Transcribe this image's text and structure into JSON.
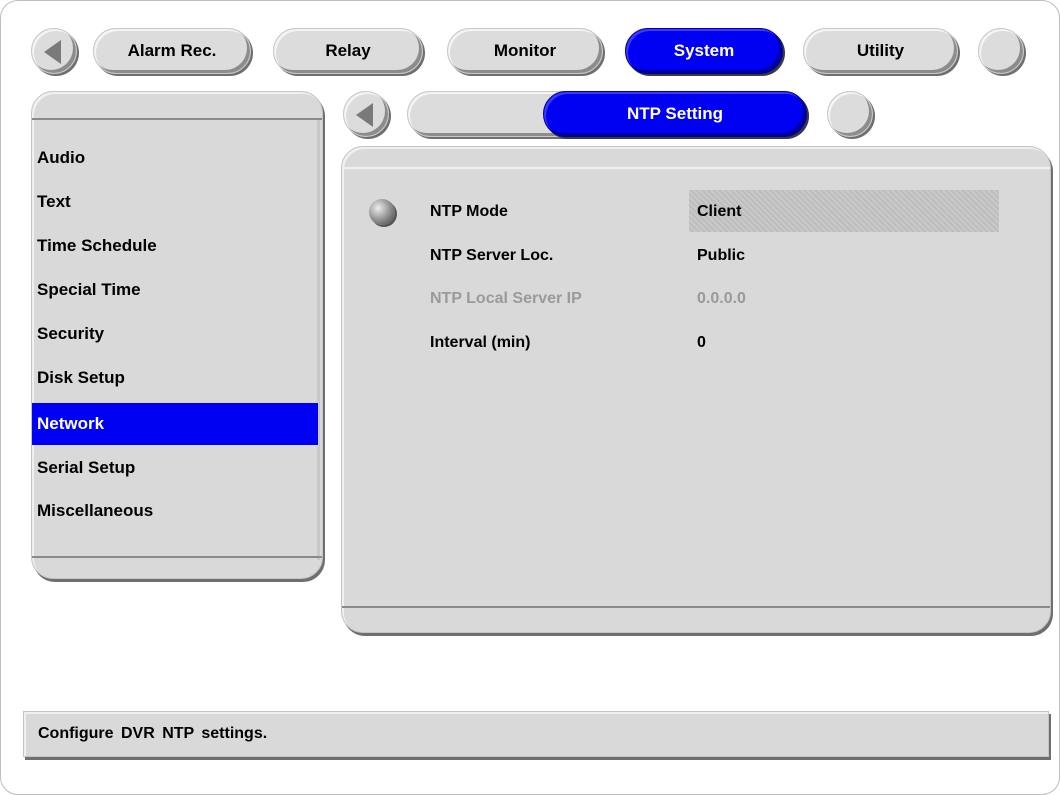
{
  "top_tabs": [
    {
      "label": "Alarm Rec.",
      "active": false
    },
    {
      "label": "Relay",
      "active": false
    },
    {
      "label": "Monitor",
      "active": false
    },
    {
      "label": "System",
      "active": true
    },
    {
      "label": "Utility",
      "active": false
    }
  ],
  "sub_tab": {
    "label": "NTP Setting"
  },
  "sidebar": {
    "items": [
      {
        "label": "Audio"
      },
      {
        "label": "Text"
      },
      {
        "label": "Time Schedule"
      },
      {
        "label": "Special Time"
      },
      {
        "label": "Security"
      },
      {
        "label": "Disk Setup"
      },
      {
        "label": "Network",
        "selected": true
      },
      {
        "label": "Serial Setup"
      },
      {
        "label": "Miscellaneous"
      }
    ]
  },
  "settings": [
    {
      "label": "NTP Mode",
      "value": "Client",
      "enabled": true,
      "focused": true
    },
    {
      "label": "NTP Server Loc.",
      "value": "Public",
      "enabled": true
    },
    {
      "label": "NTP Local Server IP",
      "value": "0.0.0.0",
      "enabled": false
    },
    {
      "label": "Interval (min)",
      "value": "0",
      "enabled": true
    }
  ],
  "status_bar": {
    "text": "Configure  DVR NTP settings."
  },
  "colors": {
    "accent": "#0000f2",
    "panel": "#d9d9d9",
    "disabled_text": "#9a9a9a"
  }
}
